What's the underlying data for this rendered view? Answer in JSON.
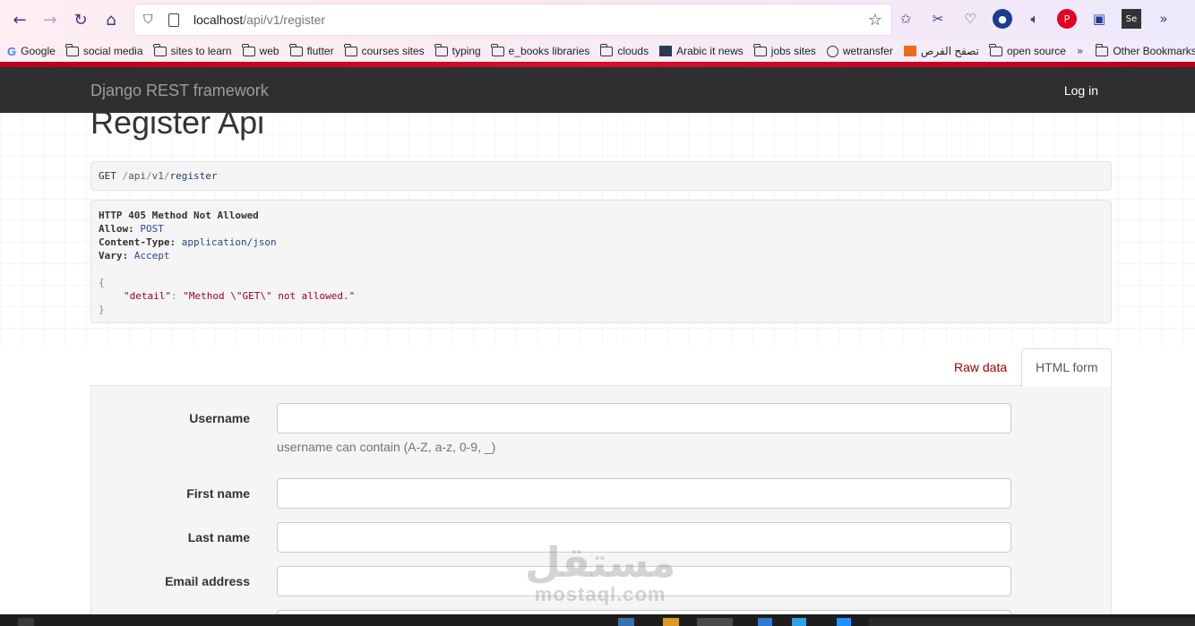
{
  "browser": {
    "url_host": "localhost",
    "url_path": "/api/v1/register",
    "bookmarks": [
      {
        "label": "Google",
        "icon": "google-icon"
      },
      {
        "label": "social media",
        "icon": "folder-icon"
      },
      {
        "label": "sites to learn",
        "icon": "folder-icon"
      },
      {
        "label": "web",
        "icon": "folder-icon"
      },
      {
        "label": "flutter",
        "icon": "folder-icon"
      },
      {
        "label": "courses sites",
        "icon": "folder-icon"
      },
      {
        "label": "typing",
        "icon": "folder-icon"
      },
      {
        "label": "e_books libraries",
        "icon": "folder-icon"
      },
      {
        "label": "clouds",
        "icon": "folder-icon"
      },
      {
        "label": "Arabic it news",
        "icon": "site-icon"
      },
      {
        "label": "jobs sites",
        "icon": "folder-icon"
      },
      {
        "label": "wetransfer",
        "icon": "globe-icon"
      },
      {
        "label": "تصفح الفرص",
        "icon": "site-icon"
      },
      {
        "label": "open source",
        "icon": "folder-icon"
      },
      {
        "label": "Other Bookmarks",
        "icon": "folder-icon"
      }
    ]
  },
  "navbar": {
    "brand": "Django REST framework",
    "login": "Log in"
  },
  "page": {
    "title": "Register Api"
  },
  "request": {
    "method": "GET",
    "seg1": "api",
    "seg2": "v1",
    "seg3": "register"
  },
  "response": {
    "status": "HTTP 405 Method Not Allowed",
    "allow_key": "Allow:",
    "allow_val": "POST",
    "ct_key": "Content-Type:",
    "ct_val": "application/json",
    "vary_key": "Vary:",
    "vary_val": "Accept",
    "open_brace": "{",
    "detail_key": "\"detail\"",
    "detail_val": "\"Method \\\"GET\\\" not allowed.\"",
    "close_brace": "}"
  },
  "tabs": {
    "raw": "Raw data",
    "html": "HTML form"
  },
  "form": {
    "username_label": "Username",
    "username_help": "username can contain (A-Z, a-z, 0-9, _)",
    "first_name_label": "First name",
    "last_name_label": "Last name",
    "email_label": "Email address"
  },
  "watermark": {
    "arabic": "مستقل",
    "latin": "mostaql.com"
  },
  "colors": {
    "navbar_bg": "#2f2f2f",
    "accent_red": "#a30000",
    "link_blue": "#1f3b66"
  }
}
